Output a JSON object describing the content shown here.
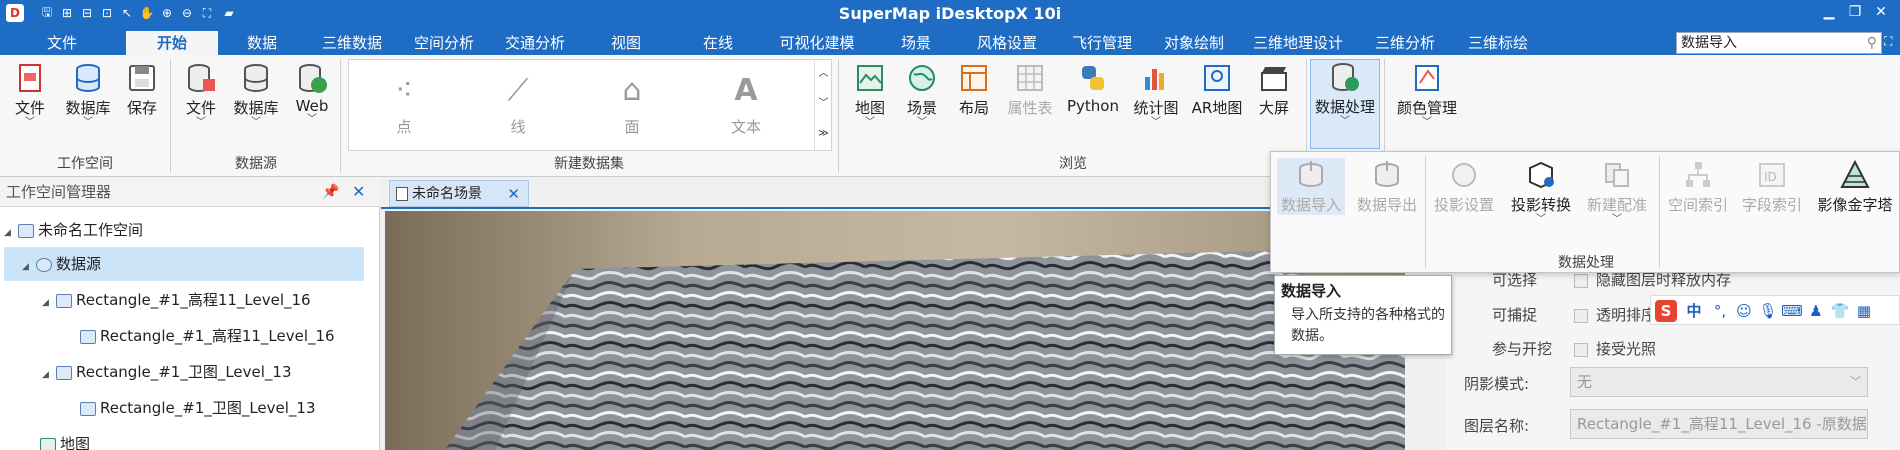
{
  "app": {
    "title": "SuperMap iDesktopX 10i",
    "logo_text": "D"
  },
  "menu_tabs": [
    {
      "label": "文件"
    },
    {
      "label": "开始"
    },
    {
      "label": "数据"
    },
    {
      "label": "三维数据"
    },
    {
      "label": "空间分析"
    },
    {
      "label": "交通分析"
    },
    {
      "label": "视图"
    },
    {
      "label": "在线"
    },
    {
      "label": "可视化建模"
    },
    {
      "label": "场景"
    },
    {
      "label": "风格设置"
    },
    {
      "label": "飞行管理"
    },
    {
      "label": "对象绘制"
    },
    {
      "label": "三维地理设计"
    },
    {
      "label": "三维分析"
    },
    {
      "label": "三维标绘"
    }
  ],
  "search": {
    "value": "数据导入"
  },
  "ribbon": {
    "workspace": {
      "group_label": "工作空间",
      "file": "文件",
      "database": "数据库",
      "save": "保存"
    },
    "datasource": {
      "group_label": "数据源",
      "file": "文件",
      "database": "数据库",
      "web": "Web"
    },
    "new_dataset": {
      "group_label": "新建数据集",
      "point": "点",
      "line": "线",
      "region": "面",
      "text": "文本"
    },
    "browse": {
      "group_label": "浏览",
      "map": "地图",
      "scene": "场景",
      "layout": "布局",
      "attribute_table": "属性表",
      "python": "Python",
      "stat_chart": "统计图",
      "ar_map": "AR地图",
      "big_screen": "大屏"
    },
    "data_processing": {
      "label": "数据处理"
    },
    "color_management": {
      "label": "颜色管理"
    }
  },
  "data_processing_panel": {
    "group_label": "数据处理",
    "import": "数据导入",
    "export": "数据导出",
    "projection_setting": "投影设置",
    "projection_transform": "投影转换",
    "new_registration": "新建配准",
    "spatial_index": "空间索引",
    "field_index": "字段索引",
    "image_pyramid": "影像金字塔"
  },
  "tooltip": {
    "title": "数据导入",
    "body": "导入所支持的各种格式的数据。"
  },
  "workspace_manager": {
    "title": "工作空间管理器",
    "tree": [
      {
        "label": "未命名工作空间"
      },
      {
        "label": "数据源"
      },
      {
        "label": "Rectangle_#1_高程11_Level_16"
      },
      {
        "label": "Rectangle_#1_高程11_Level_16"
      },
      {
        "label": "Rectangle_#1_卫图_Level_13"
      },
      {
        "label": "Rectangle_#1_卫图_Level_13"
      },
      {
        "label": "地图"
      }
    ]
  },
  "document_tab": {
    "label": "未命名场景"
  },
  "layer_properties": {
    "selectable": "可选择",
    "release_memory": "隐藏图层时释放内存",
    "snappable": "可捕捉",
    "transparent_sort": "透明排序",
    "participate_clip": "参与开挖",
    "accept_light": "接受光照",
    "shadow_mode_label": "阴影模式:",
    "shadow_mode_value": "无",
    "layer_name_label": "图层名称:",
    "layer_name_value": "Rectangle_#1_高程11_Level_16 -原数据"
  },
  "ime_toolbar": {
    "logo": "S",
    "mode": "中"
  },
  "colors": {
    "title_bar": "#1e6cc4",
    "accent": "#1e6cc4",
    "selection": "#cce4f7"
  }
}
